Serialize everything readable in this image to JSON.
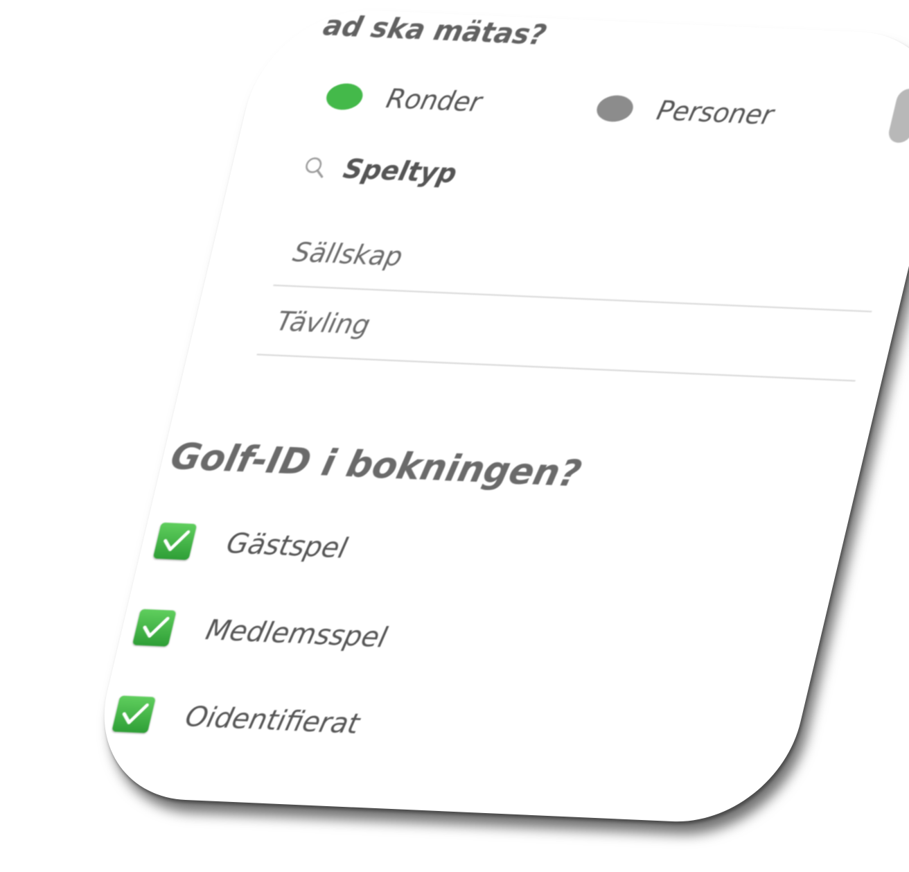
{
  "header": {
    "title": "ad ska mätas?"
  },
  "measure": {
    "options": [
      {
        "label": "Ronder",
        "selected": true,
        "color": "#44b94a"
      },
      {
        "label": "Personer",
        "selected": false,
        "color": "#8c8c8c"
      }
    ]
  },
  "search": {
    "icon": "search-icon",
    "label": "Speltyp"
  },
  "speltyp_list": {
    "items": [
      {
        "label": "Sällskap"
      },
      {
        "label": "Tävling"
      }
    ]
  },
  "golfid": {
    "title": "Golf-ID i bokningen?",
    "options": [
      {
        "label": "Gästspel",
        "checked": true
      },
      {
        "label": "Medlemsspel",
        "checked": true
      },
      {
        "label": "Oidentifierat",
        "checked": true
      }
    ],
    "check_color": "#3bb347"
  }
}
